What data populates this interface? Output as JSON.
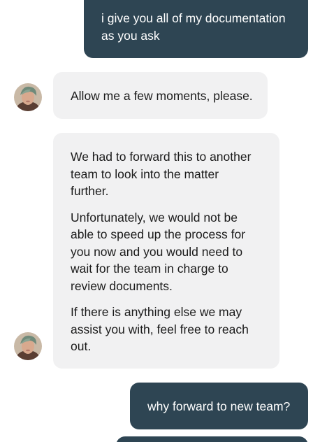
{
  "conversation": {
    "messages": [
      {
        "sender": "user",
        "paragraphs": [
          "i give you all of my documentation as you ask"
        ]
      },
      {
        "sender": "agent",
        "paragraphs": [
          "Allow me a few moments, please."
        ]
      },
      {
        "sender": "agent",
        "paragraphs": [
          "We had to forward this to another team to look into the matter further.",
          "Unfortunately, we would not be able to speed up the process for you now and you would need to wait for the team in charge to review documents.",
          "If there is anything else we may assist you with, feel free to reach out."
        ]
      },
      {
        "sender": "user",
        "paragraphs": [
          "why forward to new team?"
        ]
      }
    ]
  },
  "colors": {
    "outgoing_bubble": "#2e4553",
    "incoming_bubble": "#f1f1f2",
    "page_background": "#ffffff"
  },
  "icons": {
    "agent_avatar": "agent-avatar-photo"
  }
}
